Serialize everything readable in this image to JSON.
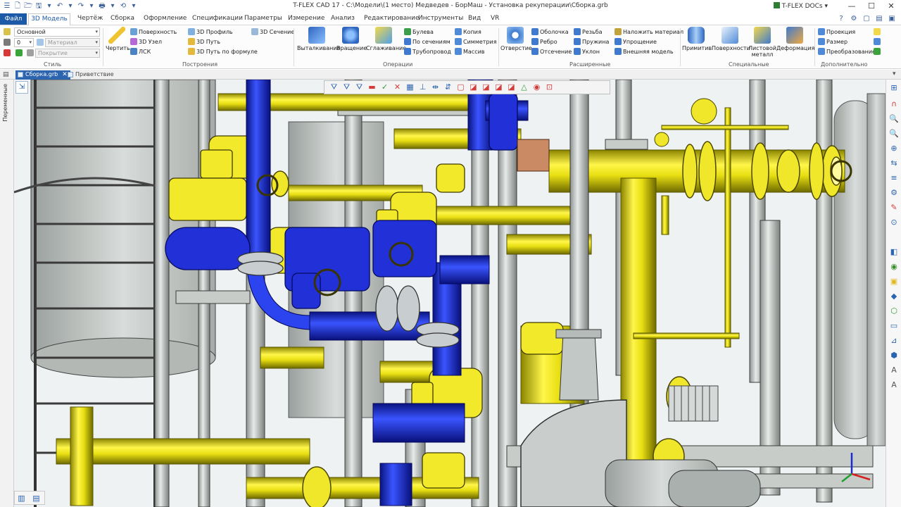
{
  "window": {
    "title": "T-FLEX CAD 17 - C:\\Модели\\(1 место) Медведев - БорМаш - Установка рекуперации\\Сборка.grb",
    "docs_button": "T-FLEX DOCs",
    "docs_caret": "▾",
    "minimize": "—",
    "maximize": "☐",
    "close": "✕"
  },
  "quick_access": [
    "☰",
    "🗋",
    "🗁",
    "🖫",
    "▾",
    "↶",
    "▾",
    "↷",
    "▾",
    "🖶",
    "▾",
    "⟲",
    "▾"
  ],
  "menu": {
    "file": "Файл",
    "active_tab": "3D Модель",
    "tabs": [
      "Чертёж",
      "Сборка",
      "Оформление",
      "Спецификации",
      "Параметры",
      "Измерение",
      "Анализ",
      "Редактирование",
      "Инструменты",
      "Вид",
      "VR"
    ]
  },
  "menu_right_icons": [
    "?",
    "⚙",
    "▢",
    "▤",
    "▣"
  ],
  "ribbon": {
    "style": {
      "layer": "Основной",
      "linetype": "0",
      "material": "Материал",
      "coating": "Покрытие",
      "label": "Стиль"
    },
    "construct": {
      "draw": "Чертить",
      "surface": "Поверхность",
      "node3d": "3D Узел",
      "lcs": "ЛСК",
      "profile3d": "3D Профиль",
      "path3d": "3D Путь",
      "path_formula": "3D Путь по формуле",
      "section3d": "3D Сечение",
      "label": "Построения"
    },
    "operations": {
      "extrude": "Выталкивание",
      "rotate": "Вращение",
      "smooth": "Сглаживание",
      "boolean": "Булева",
      "by_sections": "По сечениям",
      "pipeline": "Трубопровод",
      "copy": "Копия",
      "symmetry": "Симметрия",
      "array": "Массив",
      "label": "Операции"
    },
    "extended": {
      "hole": "Отверстие",
      "shell": "Оболочка",
      "rib": "Ребро",
      "cut": "Отсечение",
      "thread": "Резьба",
      "spring": "Пружина",
      "slope": "Уклон",
      "apply_material": "Наложить материал",
      "simplify": "Упрощение",
      "external_model": "Внешняя модель",
      "label": "Расширенные"
    },
    "special": {
      "primitive": "Примитив",
      "surfaces": "Поверхности",
      "sheet_metal_1": "Листовой",
      "sheet_metal_2": "металл",
      "deformation": "Деформация",
      "label": "Специальные"
    },
    "extra": {
      "projection": "Проекция",
      "dimension": "Размер",
      "transform": "Преобразование",
      "label": "Дополнительно"
    }
  },
  "document_tabs": [
    {
      "label": "Сборка.grb",
      "active": true
    },
    {
      "label": "Приветствие",
      "active": false
    }
  ],
  "doc_close": "✕",
  "left_panel": {
    "label": "Переменные"
  },
  "view_toolbar_icons": [
    "⛛",
    "⛛",
    "⛛",
    "▬",
    "✓",
    "✕",
    "▦",
    "⊥",
    "⇹",
    "⇵",
    "▢",
    "◪",
    "◪",
    "◪",
    "◪",
    "△",
    "◉",
    "⊡"
  ],
  "right_toolbar_icons": [
    "⊞",
    "∩",
    "🔍",
    "🔍",
    "⊕",
    "⇆",
    "≡",
    "⚙",
    "✎",
    "⊙",
    "◧",
    "◉",
    "▣",
    "◆",
    "⬡",
    "▭",
    "⊿",
    "⬢",
    "A",
    "A"
  ],
  "view_nav": "⇲",
  "bottom_left_icons": [
    "▥",
    "▤"
  ],
  "colors": {
    "file_tab": "#1c5aa8",
    "active_doc_tab": "#2c64b0",
    "pipe_yellow": "#f2e92a",
    "pipe_blue": "#1b2fd6",
    "steel": "#b9bfbd",
    "background": "#eef2f3"
  }
}
